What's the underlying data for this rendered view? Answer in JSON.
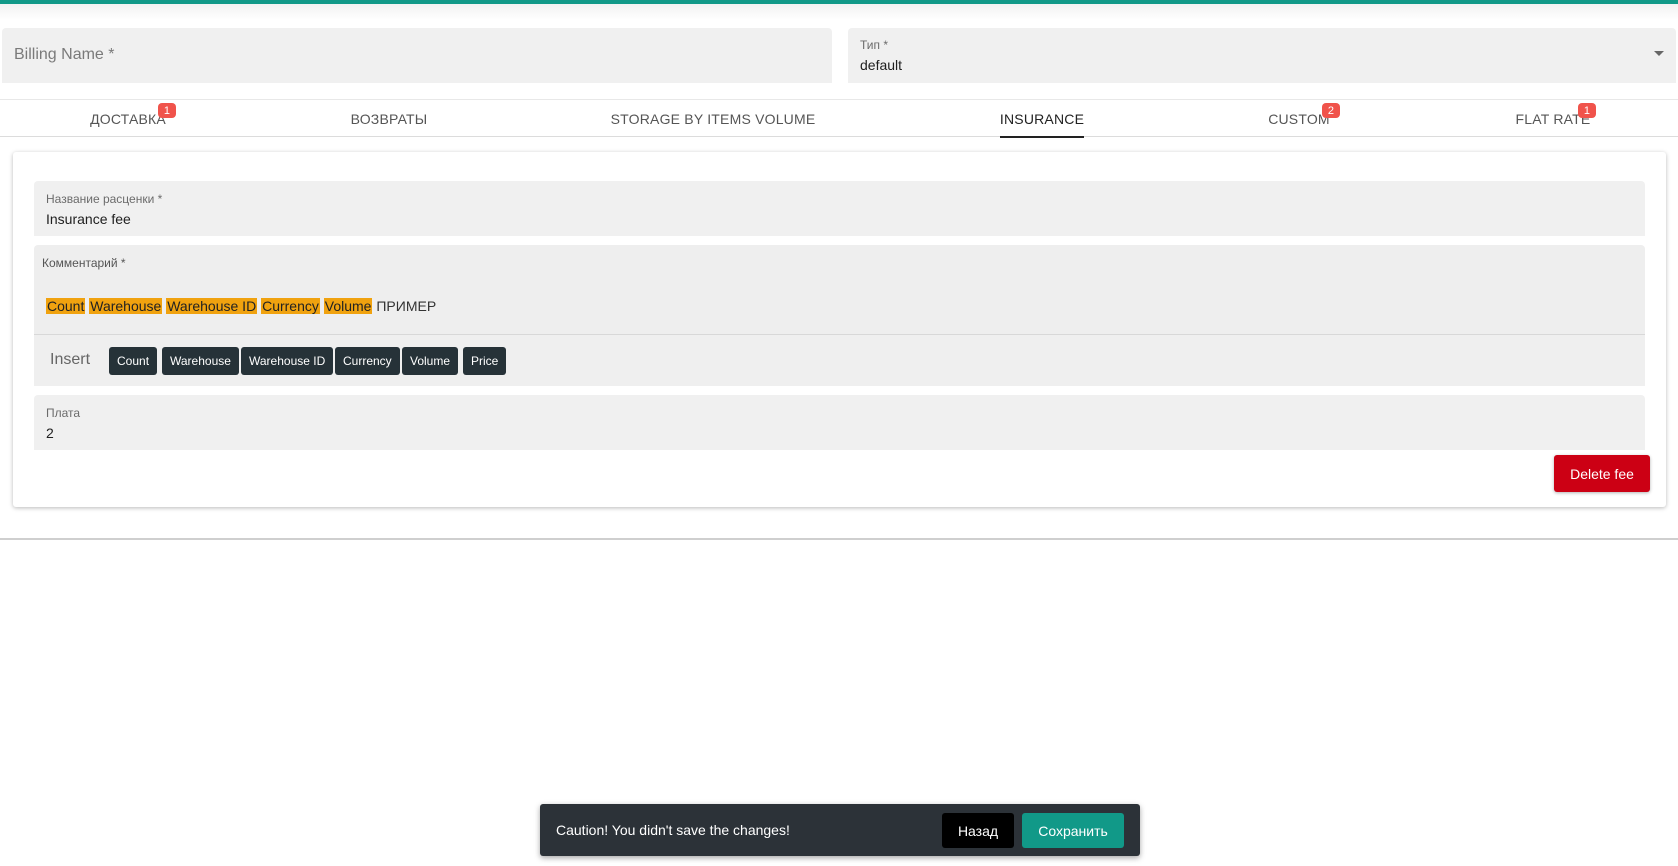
{
  "header": {
    "billing_name_placeholder": "Billing Name *",
    "type_label": "Тип *",
    "type_value": "default"
  },
  "tabs": [
    {
      "label": "ДОСТАВКА",
      "badge": "1"
    },
    {
      "label": "ВОЗВРАТЫ",
      "badge": ""
    },
    {
      "label": "STORAGE BY ITEMS VOLUME",
      "badge": ""
    },
    {
      "label": "INSURANCE",
      "badge": ""
    },
    {
      "label": "CUSTOM",
      "badge": "2"
    },
    {
      "label": "FLAT RATE",
      "badge": "1"
    }
  ],
  "fee": {
    "rate_name_label": "Название расценки *",
    "rate_name_value": "Insurance fee",
    "comment_label": "Комментарий *",
    "comment_chips": [
      "Count",
      "Warehouse",
      "Warehouse ID",
      "Currency",
      "Volume"
    ],
    "comment_tail": "ПРИМЕР",
    "insert_label": "Insert",
    "insert_buttons": [
      "Count",
      "Warehouse",
      "Warehouse ID",
      "Currency",
      "Volume",
      "Price"
    ],
    "payment_label": "Плата",
    "payment_value": "2",
    "delete_label": "Delete fee"
  },
  "snackbar": {
    "message": "Caution! You didn't save the changes!",
    "back_label": "Назад",
    "save_label": "Сохранить"
  },
  "colors": {
    "accent": "#119988",
    "highlight": "#f0a20f",
    "badge": "#f0534b",
    "danger": "#cc0014",
    "chip_dark": "#263238"
  }
}
